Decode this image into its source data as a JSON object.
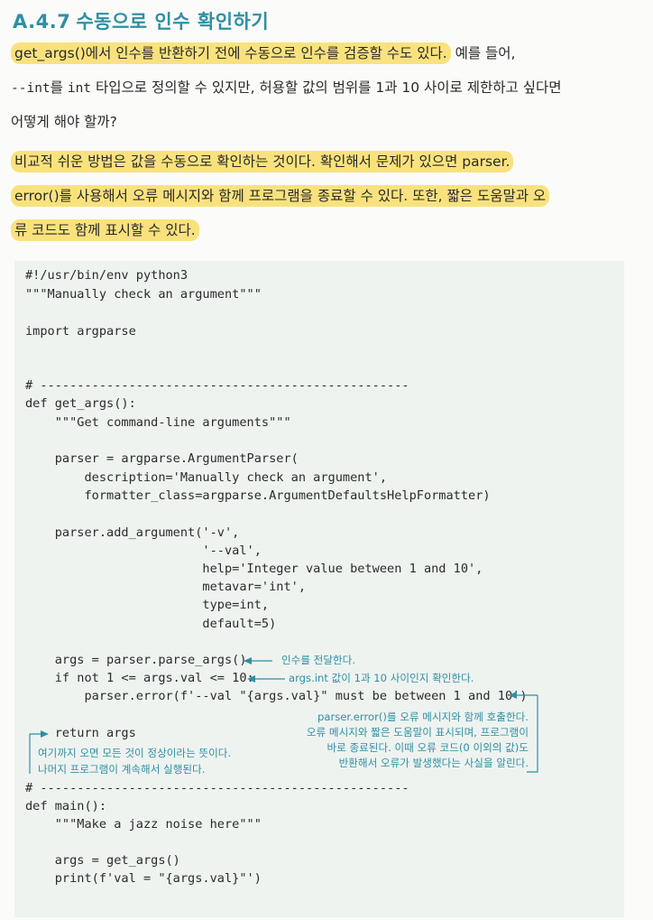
{
  "heading": {
    "number": "A.4.7",
    "title": "수동으로 인수 확인하기"
  },
  "paragraph1": {
    "line1_highlight": "get_args()에서 인수를 반환하기 전에 수동으로 인수를 검증할 수도 있다.",
    "line1_rest": " 예를 들어,",
    "line2_code": "--int",
    "line2_text1": "를 ",
    "line2_code2": "int",
    "line2_text2": " 타입으로 정의할 수 있지만, 허용할 값의 범위를 1과 10 사이로 제한하고 싶다면",
    "line3": "어떻게 해야 할까?"
  },
  "paragraph2": {
    "line1": "비교적 쉬운 방법은 값을 수동으로 확인하는 것이다. 확인해서 문제가 있으면 parser.",
    "line2": "error()를 사용해서 오류 메시지와 함께 프로그램을 종료할 수 있다. 또한, 짧은 도움말과 오",
    "line3": "류 코드도 함께 표시할 수 있다."
  },
  "code": {
    "l1": "#!/usr/bin/env python3",
    "l2": "\"\"\"Manually check an argument\"\"\"",
    "l3": "import argparse",
    "l4": "# --------------------------------------------------",
    "l5": "def get_args():",
    "l6": "    \"\"\"Get command-line arguments\"\"\"",
    "l7": "    parser = argparse.ArgumentParser(",
    "l8": "        description='Manually check an argument',",
    "l9": "        formatter_class=argparse.ArgumentDefaultsHelpFormatter)",
    "l10": "    parser.add_argument('-v',",
    "l11": "                        '--val',",
    "l12": "                        help='Integer value between 1 and 10',",
    "l13": "                        metavar='int',",
    "l14": "                        type=int,",
    "l15": "                        default=5)",
    "l16": "    args = parser.parse_args()",
    "l17": "    if not 1 <= args.val <= 10:",
    "l18": "        parser.error(f'--val \"{args.val}\" must be between 1 and 10')",
    "l19": "    return args",
    "l20": "# --------------------------------------------------",
    "l21": "def main():",
    "l22": "    \"\"\"Make a jazz noise here\"\"\"",
    "l23": "    args = get_args()",
    "l24": "    print(f'val = \"{args.val}\"')"
  },
  "annotations": {
    "parse": "인수를 전달한다.",
    "check": "args.int 값이 1과 10 사이인지 확인한다.",
    "error1": "parser.error()를 오류 메시지와 함께 호출한다.",
    "error2": "오류 메시지와 짧은 도움말이 표시되며, 프로그램이",
    "error3": "바로 종료된다. 이때 오류 코드(0 이외의 값)도",
    "error4": "반환해서 오류가 발생했다는 사실을 알린다.",
    "return1": "여기까지 오면 모든 것이 정상이라는 뜻이다.",
    "return2": "나머지 프로그램이 계속해서 실행된다."
  },
  "colors": {
    "accent": "#2f8fa3",
    "highlight": "#f9e27e",
    "code_bg": "#eef3f0"
  }
}
